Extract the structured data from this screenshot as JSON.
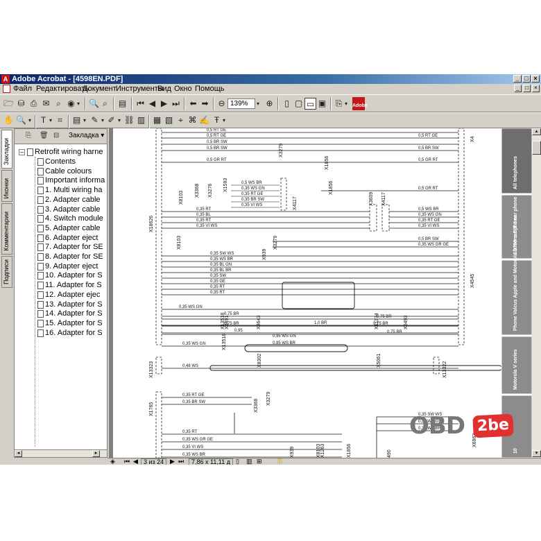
{
  "window": {
    "title": "Adobe Acrobat - [4598EN.PDF]"
  },
  "menu": [
    "Файл",
    "Редактировать",
    "Документ",
    "Инструменты",
    "Вид",
    "Окно",
    "Помощь"
  ],
  "toolbar": {
    "zoom_value": "139%"
  },
  "side_tabs": [
    "Закладки",
    "Иконки",
    "Комментарии",
    "Подписи"
  ],
  "bookmarks": {
    "panel_title": "Закладка",
    "root": "Retrofit wiring harne",
    "items": [
      "Contents",
      "Cable colours",
      "Important informa",
      "1. Multi wiring ha",
      "2. Adapter cable",
      "3. Adapter cable",
      "4. Switch module",
      "5. Adapter cable",
      "6. Adapter eject",
      "7. Adapter for SE",
      "8. Adapter for SE",
      "9. Adapter eject",
      "10. Adapter for S",
      "11. Adapter for S",
      "12. Adapter ejec",
      "13. Adapter for S",
      "14. Adapter for S",
      "15. Adapter for S",
      "16. Adapter for S"
    ]
  },
  "status": {
    "page_indicator": "3 из 24",
    "page_size": "7,86 x 11,11 д"
  },
  "schematic": {
    "connector_labels": [
      "X18626",
      "X13323",
      "X1765",
      "X4545",
      "X13322",
      "X4117",
      "X3609",
      "X4117",
      "X8103",
      "X3368",
      "X1593",
      "X3276",
      "X8103",
      "X3279",
      "X3279",
      "X1856",
      "X1856",
      "X939",
      "X6491",
      "X9643",
      "X11374",
      "X6493",
      "X13518",
      "X13518",
      "X8302",
      "X5061",
      "X3368",
      "X3279",
      "X939",
      "X8103",
      "X1263",
      "X1856",
      "X6963",
      "X4",
      "490"
    ],
    "wire_labels": [
      "0,5  RT GE",
      "0,5  RT GE",
      "0,5  BR SW",
      "0,5  BR SW",
      "0,5  GR RT",
      "0,5  RT GE",
      "0,5  BR SW",
      "0,5  GR RT",
      "0,5  WS BR",
      "0,35 WS GN",
      "0,35 RT GE",
      "0,35 BR SW",
      "0,35 VI WS",
      "0,5  GR RT",
      "0,35 RT",
      "0,35 BL",
      "0,35 RT",
      "0,35 VI WS",
      "0,5  WS BR",
      "0,35 WS GN",
      "0,35 RT GE",
      "0,35 VI WS",
      "0,5  BR SW",
      "0,35 WS GR GE",
      "0,35 SW WS",
      "0,35 WS BR",
      "0,35 BL GN",
      "0,35 BL BR",
      "0,35 SW",
      "0,35 GE",
      "0,35 RT",
      "0,35 RT",
      "0,35 WS GN",
      "0,75 BR",
      "0,75 BR",
      "0,75 BR",
      "0,75 BR",
      "0,95",
      "1,0 BR",
      "0,75 BR",
      "0,95 WS GN",
      "0,95 WS BR",
      "0,35 WS GN",
      "0,48 WS",
      "0,35 RT GE",
      "0,35 BR SW",
      "0,35 RT",
      "0,35 WS GR GE",
      "0,35 VI WS",
      "0,35 WS BR",
      "0,35 SW WS",
      "0,35 WS GN",
      "0,35 WS BR"
    ],
    "right_tabs": [
      "All telephones",
      "Siemens BIT II car phone",
      "Phone Valcus Apple and Motorola D700 car phone",
      "Motorola V series",
      "10"
    ]
  },
  "watermark": {
    "obd": "OBD",
    "brand": "2be"
  }
}
